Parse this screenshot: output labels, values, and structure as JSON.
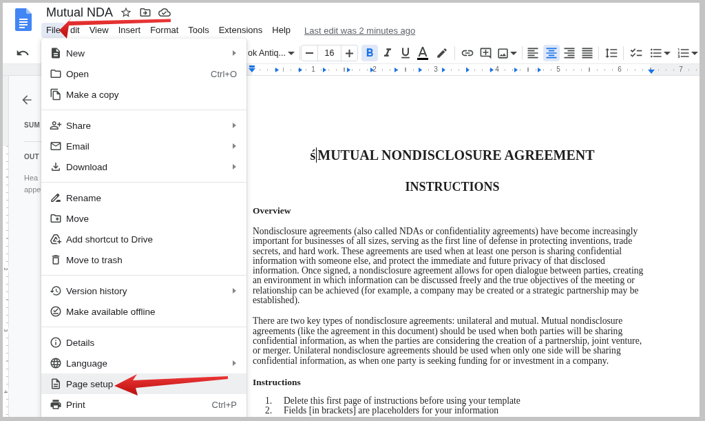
{
  "app": {
    "title": "Mutual NDA"
  },
  "menu_bar": {
    "items": [
      {
        "label": "File",
        "selected": true
      },
      {
        "label": "dit",
        "selected": false
      },
      {
        "label": "View",
        "selected": false
      },
      {
        "label": "Insert",
        "selected": false
      },
      {
        "label": "Format",
        "selected": false
      },
      {
        "label": "Tools",
        "selected": false
      },
      {
        "label": "Extensions",
        "selected": false
      },
      {
        "label": "Help",
        "selected": false
      }
    ],
    "last_edit": "Last edit was 2 minutes ago"
  },
  "toolbar": {
    "font": "ok Antiq...",
    "font_size": "16",
    "bold": true,
    "italic": false,
    "underline": false,
    "alignment_buttons": [
      {
        "selected": false
      },
      {
        "selected": true
      },
      {
        "selected": false
      },
      {
        "selected": false
      }
    ]
  },
  "ruler": {
    "marks": [
      "1",
      "2",
      "3",
      "4",
      "5",
      "6",
      "7"
    ]
  },
  "vertical_ruler": {
    "marks": [
      "2",
      "3",
      "4"
    ]
  },
  "sidebar": {
    "summary_heading": "SUM",
    "outline_heading": "OUT",
    "hint_lines": [
      "Hea",
      "appe"
    ]
  },
  "file_menu": {
    "groups": [
      [
        {
          "label": "New",
          "submenu": true,
          "highlighted": false
        },
        {
          "label": "Open",
          "shortcut": "Ctrl+O",
          "submenu": false,
          "highlighted": false
        },
        {
          "label": "Make a copy",
          "submenu": false,
          "highlighted": false
        }
      ],
      [
        {
          "label": "Share",
          "submenu": true,
          "highlighted": false
        },
        {
          "label": "Email",
          "submenu": true,
          "highlighted": false
        },
        {
          "label": "Download",
          "submenu": true,
          "highlighted": false
        }
      ],
      [
        {
          "label": "Rename",
          "submenu": false,
          "highlighted": false
        },
        {
          "label": "Move",
          "submenu": false,
          "highlighted": false
        },
        {
          "label": "Add shortcut to Drive",
          "submenu": false,
          "highlighted": false
        },
        {
          "label": "Move to trash",
          "submenu": false,
          "highlighted": false
        }
      ],
      [
        {
          "label": "Version history",
          "submenu": true,
          "highlighted": false
        },
        {
          "label": "Make available offline",
          "submenu": false,
          "highlighted": false
        }
      ],
      [
        {
          "label": "Details",
          "submenu": false,
          "highlighted": false
        },
        {
          "label": "Language",
          "submenu": true,
          "highlighted": false
        },
        {
          "label": "Page setup",
          "submenu": false,
          "highlighted": true
        },
        {
          "label": "Print",
          "shortcut": "Ctrl+P",
          "submenu": false,
          "highlighted": false
        }
      ]
    ]
  },
  "document": {
    "title_prefix": "ś",
    "cursor": true,
    "title": "MUTUAL NONDISCLOSURE AGREEMENT",
    "subtitle": "INSTRUCTIONS",
    "sections": [
      {
        "heading": "Overview",
        "paragraphs": [
          "Nondisclosure agreements (also called NDAs or confidentiality agreements) have become increasingly important for businesses of all sizes, serving as the first line of defense in protecting inventions, trade secrets, and hard work. These agreements are used when at least one person is sharing confidential information with someone else, and protect the immediate and future privacy of that disclosed information. Once signed, a nondisclosure agreement allows for open dialogue between parties, creating an environment in which information can be discussed freely and the true objectives of the meeting or relationship can be achieved (for example, a company may be created or a strategic partnership may be established).",
          "There are two key types of nondisclosure agreements: unilateral and mutual. Mutual nondisclosure agreements (like the agreement in this document) should be used when both parties will be sharing confidential information, as when the parties are considering the creation of a partnership, joint venture, or merger. Unilateral nondisclosure agreements should be used when only one side will be sharing confidential information, as when one party is seeking funding for or investment in a company."
        ]
      },
      {
        "heading": "Instructions",
        "list": [
          {
            "number": "1.",
            "text": "Delete this first page of instructions before using your template"
          },
          {
            "number": "2.",
            "text": "Fields [in brackets] are placeholders for your information"
          }
        ]
      }
    ]
  }
}
